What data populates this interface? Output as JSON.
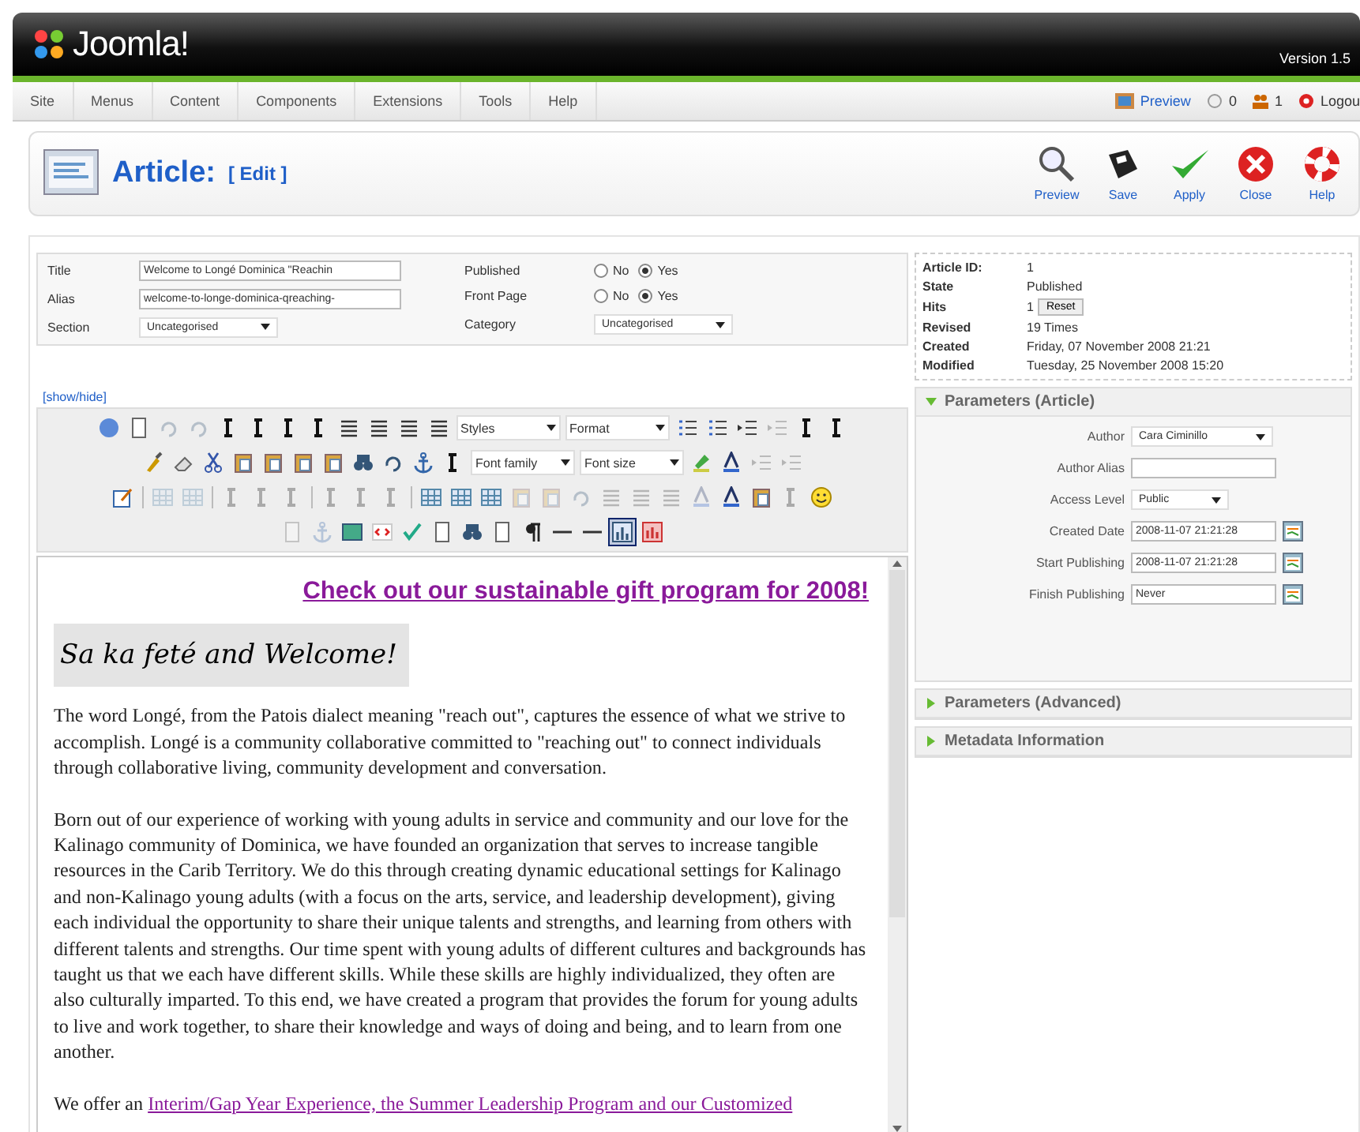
{
  "header": {
    "logo": "Joomla!",
    "version": "Version 1.5"
  },
  "menu": [
    {
      "label": "Site"
    },
    {
      "label": "Menus"
    },
    {
      "label": "Content"
    },
    {
      "label": "Components"
    },
    {
      "label": "Extensions"
    },
    {
      "label": "Tools"
    },
    {
      "label": "Help"
    }
  ],
  "status": {
    "preview": "Preview",
    "messages": "0",
    "users": "1",
    "logout": "Logou"
  },
  "page": {
    "title": "Article:",
    "subtitle": "[ Edit ]"
  },
  "actions": [
    {
      "kind": "preview",
      "label": "Preview"
    },
    {
      "kind": "save",
      "label": "Save"
    },
    {
      "kind": "apply",
      "label": "Apply"
    },
    {
      "kind": "close",
      "label": "Close"
    },
    {
      "kind": "help",
      "label": "Help"
    }
  ],
  "details": {
    "left": [
      {
        "kind": "text",
        "label": "Title",
        "value": "Welcome to Longé Dominica \"Reachin"
      },
      {
        "kind": "text",
        "label": "Alias",
        "value": "welcome-to-longe-dominica-qreaching-"
      },
      {
        "kind": "select",
        "label": "Section",
        "value": "Uncategorised"
      }
    ],
    "right": [
      {
        "kind": "radio",
        "label": "Published",
        "options": [
          {
            "label": "No",
            "selected": false
          },
          {
            "label": "Yes",
            "selected": true
          }
        ]
      },
      {
        "kind": "radio",
        "label": "Front Page",
        "options": [
          {
            "label": "No",
            "selected": false
          },
          {
            "label": "Yes",
            "selected": true
          }
        ]
      },
      {
        "kind": "select",
        "label": "Category",
        "value": "Uncategorised"
      }
    ]
  },
  "toggle": "[show/hide]",
  "toolbar": [
    [
      {
        "kind": "button",
        "disabled": false,
        "on": false
      },
      {
        "kind": "button",
        "disabled": false,
        "on": false
      },
      {
        "kind": "button",
        "disabled": true,
        "on": false
      },
      {
        "kind": "button",
        "disabled": true,
        "on": false
      },
      {
        "kind": "button",
        "disabled": false,
        "on": false
      },
      {
        "kind": "button",
        "disabled": false,
        "on": false
      },
      {
        "kind": "button",
        "disabled": false,
        "on": false
      },
      {
        "kind": "button",
        "disabled": false,
        "on": false
      },
      {
        "kind": "button",
        "disabled": false,
        "on": false
      },
      {
        "kind": "button",
        "disabled": false,
        "on": false
      },
      {
        "kind": "button",
        "disabled": false,
        "on": false
      },
      {
        "kind": "button",
        "disabled": false,
        "on": false
      },
      {
        "kind": "select",
        "label": "Styles"
      },
      {
        "kind": "select",
        "label": "Format"
      },
      {
        "kind": "button",
        "disabled": false,
        "on": false
      },
      {
        "kind": "button",
        "disabled": false,
        "on": false
      },
      {
        "kind": "button",
        "disabled": false,
        "on": false
      },
      {
        "kind": "button",
        "disabled": true,
        "on": false
      },
      {
        "kind": "button",
        "disabled": false,
        "on": false
      },
      {
        "kind": "button",
        "disabled": false,
        "on": false
      }
    ],
    [
      {
        "kind": "button",
        "disabled": false,
        "on": false
      },
      {
        "kind": "button",
        "disabled": false,
        "on": false
      },
      {
        "kind": "button",
        "disabled": false,
        "on": false
      },
      {
        "kind": "button",
        "disabled": false,
        "on": false
      },
      {
        "kind": "button",
        "disabled": false,
        "on": false
      },
      {
        "kind": "button",
        "disabled": false,
        "on": false
      },
      {
        "kind": "button",
        "disabled": false,
        "on": false
      },
      {
        "kind": "button",
        "disabled": false,
        "on": false
      },
      {
        "kind": "button",
        "disabled": false,
        "on": false
      },
      {
        "kind": "button",
        "disabled": false,
        "on": false
      },
      {
        "kind": "button",
        "disabled": false,
        "on": false
      },
      {
        "kind": "select",
        "label": "Font family"
      },
      {
        "kind": "select",
        "label": "Font size"
      },
      {
        "kind": "button",
        "disabled": false,
        "on": false
      },
      {
        "kind": "button",
        "disabled": false,
        "on": false
      },
      {
        "kind": "button",
        "disabled": true,
        "on": false
      },
      {
        "kind": "button",
        "disabled": true,
        "on": false
      }
    ],
    [
      {
        "kind": "button",
        "disabled": false,
        "on": false
      },
      {
        "kind": "separator"
      },
      {
        "kind": "button",
        "disabled": true,
        "on": false
      },
      {
        "kind": "button",
        "disabled": true,
        "on": false
      },
      {
        "kind": "separator"
      },
      {
        "kind": "button",
        "disabled": true,
        "on": false
      },
      {
        "kind": "button",
        "disabled": true,
        "on": false
      },
      {
        "kind": "button",
        "disabled": true,
        "on": false
      },
      {
        "kind": "separator"
      },
      {
        "kind": "button",
        "disabled": true,
        "on": false
      },
      {
        "kind": "button",
        "disabled": true,
        "on": false
      },
      {
        "kind": "button",
        "disabled": true,
        "on": false
      },
      {
        "kind": "separator"
      },
      {
        "kind": "button",
        "disabled": false,
        "on": false
      },
      {
        "kind": "button",
        "disabled": false,
        "on": false
      },
      {
        "kind": "button",
        "disabled": false,
        "on": false
      },
      {
        "kind": "button",
        "disabled": true,
        "on": false
      },
      {
        "kind": "button",
        "disabled": true,
        "on": false
      },
      {
        "kind": "button",
        "disabled": true,
        "on": false
      },
      {
        "kind": "button",
        "disabled": true,
        "on": false
      },
      {
        "kind": "button",
        "disabled": true,
        "on": false
      },
      {
        "kind": "button",
        "disabled": true,
        "on": false
      },
      {
        "kind": "button",
        "disabled": true,
        "on": false
      },
      {
        "kind": "button",
        "disabled": false,
        "on": false
      },
      {
        "kind": "button",
        "disabled": false,
        "on": false
      },
      {
        "kind": "button",
        "disabled": true,
        "on": false
      },
      {
        "kind": "button",
        "disabled": false,
        "on": false
      }
    ],
    [
      {
        "kind": "button",
        "disabled": true,
        "on": false
      },
      {
        "kind": "button",
        "disabled": true,
        "on": false
      },
      {
        "kind": "button",
        "disabled": false,
        "on": false
      },
      {
        "kind": "button",
        "disabled": false,
        "on": false
      },
      {
        "kind": "button",
        "disabled": false,
        "on": false
      },
      {
        "kind": "button",
        "disabled": false,
        "on": false
      },
      {
        "kind": "button",
        "disabled": false,
        "on": false
      },
      {
        "kind": "button",
        "disabled": false,
        "on": false
      },
      {
        "kind": "button",
        "disabled": false,
        "on": false
      },
      {
        "kind": "button",
        "disabled": false,
        "on": false
      },
      {
        "kind": "button",
        "disabled": false,
        "on": false
      },
      {
        "kind": "button",
        "disabled": false,
        "on": true
      },
      {
        "kind": "button",
        "disabled": false,
        "on": false
      }
    ]
  ],
  "editor": {
    "link": "Check out our sustainable gift program for 2008!",
    "banner": "Sa ka feté and Welcome!",
    "paragraphs": [
      {
        "text": "The word Longé, from the Patois dialect meaning \"reach out\", captures the essence of what we strive to accomplish. Longé is a community collaborative committed to \"reaching out\" to connect individuals through collaborative living, community development and conversation."
      },
      {
        "text": "Born out of our experience of working with young adults in service and community and our love for the Kalinago community of Dominica, we have founded an organization that serves to increase tangible resources in the Carib Territory. We do this through creating dynamic educational settings for Kalinago and non-Kalinago young adults (with a focus on the arts, service, and leadership development), giving each individual the opportunity to share their unique talents and strengths, and learning from others with different talents and strengths. Our time spent with young adults of different cultures and backgrounds has taught us that we each have different skills. While these skills are highly individualized, they often are also culturally imparted. To this end, we have created a program that provides the forum for young adults to live and work together, to share their knowledge and ways of doing and being, and to learn from one another."
      },
      {
        "text": "We offer an ",
        "link": "Interim/Gap Year Experience, the Summer Leadership Program and our Customized"
      }
    ]
  },
  "info": [
    {
      "kind": "text",
      "label": "Article ID:",
      "value": "1"
    },
    {
      "kind": "text",
      "label": "State",
      "value": "Published"
    },
    {
      "kind": "reset",
      "label": "Hits",
      "value": "1",
      "button": "Reset"
    },
    {
      "kind": "text",
      "label": "Revised",
      "value": "19 Times"
    },
    {
      "kind": "text",
      "label": "Created",
      "value": "Friday, 07 November 2008 21:21"
    },
    {
      "kind": "text",
      "label": "Modified",
      "value": "Tuesday, 25 November 2008 15:20"
    }
  ],
  "panels": [
    {
      "title": "Parameters (Article)",
      "expanded": true,
      "params": [
        {
          "kind": "select",
          "label": "Author",
          "value": "Cara Ciminillo"
        },
        {
          "kind": "text",
          "label": "Author Alias"
        },
        {
          "kind": "select",
          "label": "Access Level",
          "value": "Public"
        },
        {
          "kind": "date",
          "label": "Created Date",
          "value": "2008-11-07 21:21:28"
        },
        {
          "kind": "date",
          "label": "Start Publishing",
          "value": "2008-11-07 21:21:28"
        },
        {
          "kind": "date",
          "label": "Finish Publishing",
          "value": "Never"
        }
      ]
    },
    {
      "title": "Parameters (Advanced)",
      "expanded": false
    },
    {
      "title": "Metadata Information",
      "expanded": false
    }
  ]
}
